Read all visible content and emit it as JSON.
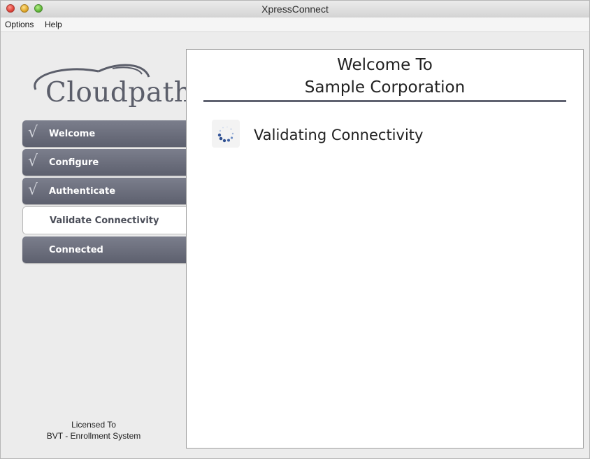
{
  "window": {
    "title": "XpressConnect"
  },
  "menu": {
    "items": [
      "Options",
      "Help"
    ]
  },
  "sidebar": {
    "logo_text": "Cloudpath",
    "steps": [
      {
        "label": "Welcome",
        "state": "completed",
        "check": "√"
      },
      {
        "label": "Configure",
        "state": "completed",
        "check": "√"
      },
      {
        "label": "Authenticate",
        "state": "completed",
        "check": "√"
      },
      {
        "label": "Validate Connectivity",
        "state": "active",
        "check": ""
      },
      {
        "label": "Connected",
        "state": "pending",
        "check": ""
      }
    ],
    "license_line1": "Licensed To",
    "license_line2": "BVT - Enrollment System"
  },
  "content": {
    "heading_line1": "Welcome To",
    "heading_line2": "Sample Corporation",
    "status_text": "Validating Connectivity",
    "status_icon": "loading-spinner-icon"
  },
  "colors": {
    "step_bg": "#6b6e7c",
    "accent_rule": "#5f6270",
    "spinner_dots": "#3d5fa3"
  }
}
